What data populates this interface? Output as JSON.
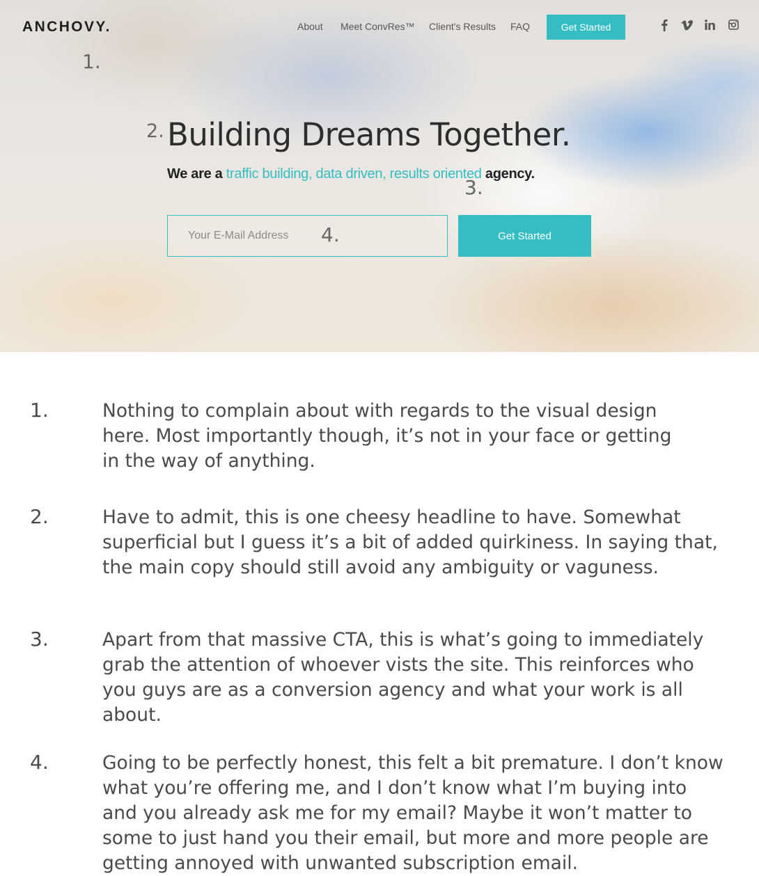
{
  "brand": {
    "logo": "ANCHOVY."
  },
  "nav": {
    "links": [
      "About",
      "Meet ConvRes™",
      "Client's Results",
      "FAQ"
    ],
    "cta": "Get Started",
    "social_icons": [
      "facebook-icon",
      "vimeo-icon",
      "linkedin-icon",
      "instagram-icon"
    ]
  },
  "hero": {
    "headline": "Building Dreams Together.",
    "sub_prefix": "We are a ",
    "sub_accent": "traffic building, data driven, results oriented",
    "sub_suffix": " agency.",
    "email_placeholder": "Your E-Mail Address",
    "cta": "Get Started"
  },
  "markers": [
    "1.",
    "2.",
    "3.",
    "4."
  ],
  "notes": [
    {
      "number": "1.",
      "text": "Nothing to complain about with regards to the visual design\nhere. Most importantly though, it’s not in your face or getting\nin the way of anything."
    },
    {
      "number": "2.",
      "text": "Have to admit, this is one cheesy headline to have.  Somewhat\nsuperficial but I guess it’s a bit of added quirkiness. In saying that,\nthe main copy should still avoid any ambiguity or vaguness."
    },
    {
      "number": "3.",
      "text": "Apart from that massive CTA, this is what’s going to immediately\ngrab the attention of whoever vists the site. This reinforces who\nyou guys are as a conversion agency and what your work is all\nabout."
    },
    {
      "number": "4.",
      "text": "Going to be perfectly honest, this felt a bit premature. I don’t know\nwhat you’re offering me, and I don’t know what I’m buying into\nand you already ask me for my email? Maybe it won’t matter to\nsome to just hand you their email, but more and more people are\ngetting annoyed with unwanted subscription email."
    }
  ],
  "colors": {
    "accent": "#34bec4",
    "text": "#4a4a4a",
    "headline": "#2d2d2d"
  }
}
